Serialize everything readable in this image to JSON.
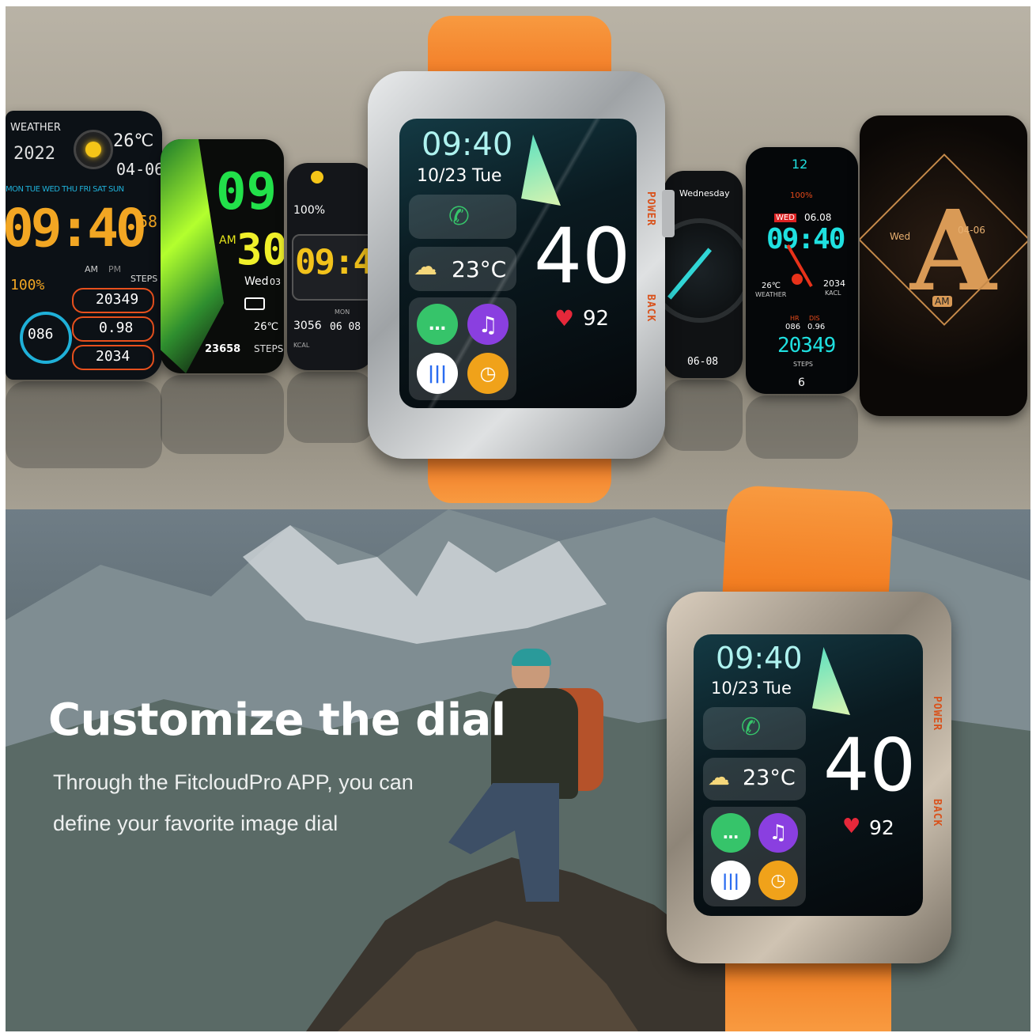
{
  "colors": {
    "strap": "#f47a21",
    "bezel": "#c9cbcc",
    "power_label": "#d9521c",
    "heart": "#e6283a",
    "call": "#36c46a",
    "music": "#8a3fe0",
    "voice": "#ffffff",
    "timer": "#f0a21a"
  },
  "watch_main": {
    "time": "09:40",
    "date": "10/23",
    "day": "Tue",
    "big_minutes": "40",
    "temperature": "23°C",
    "heart_rate": "92",
    "power_label": "POWER",
    "back_label": "BACK",
    "icons": [
      "phone-icon",
      "cloud-sun-icon",
      "message-icon",
      "music-icon",
      "voice-icon",
      "timer-icon",
      "heart-icon"
    ]
  },
  "faces": {
    "weather": {
      "title": "WEATHER",
      "year": "2022",
      "temp": "26℃",
      "date": "04-06",
      "weekdays": "MON TUE WED THU FRI SAT SUN",
      "time": "09:40",
      "seconds": "58",
      "ampm": [
        "AM",
        "PM"
      ],
      "battery": "100%",
      "steps_label": "STEPS",
      "steps": "20349",
      "distance": "0.98",
      "calories": "2034",
      "heart": "086"
    },
    "green": {
      "hour": "09",
      "minute": "30",
      "ampm": "AM",
      "day": "Wed",
      "date": "03",
      "temp": "26℃",
      "steps": "23658",
      "steps_label": "STEPS"
    },
    "lcd": {
      "battery": "100%",
      "time": "09:4",
      "kcal": "3056",
      "kcal_label": "KCAL",
      "mon": "MON",
      "date": "06 08"
    },
    "analog_dark": {
      "day": "Wednesday",
      "date": "06-08"
    },
    "cyan": {
      "twelve": "12",
      "battery": "100%",
      "day": "WED",
      "date": "06.08",
      "time": "09:40",
      "temp": "26℃",
      "weather_label": "WEATHER",
      "kcal": "2034",
      "kcal_label": "KACL",
      "hr": "HR",
      "dis": "DIS",
      "hr_val": "086",
      "dis_val": "0.96",
      "steps": "20349",
      "steps_label": "STEPS",
      "six": "6"
    },
    "gold": {
      "day": "Wed",
      "date": "04-06",
      "ampm": "AM",
      "letter": "A"
    }
  },
  "headline": "Customize the dial",
  "subtext": {
    "line1": "Through the FitcloudPro APP, you can",
    "line2": "define your favorite image dial"
  }
}
